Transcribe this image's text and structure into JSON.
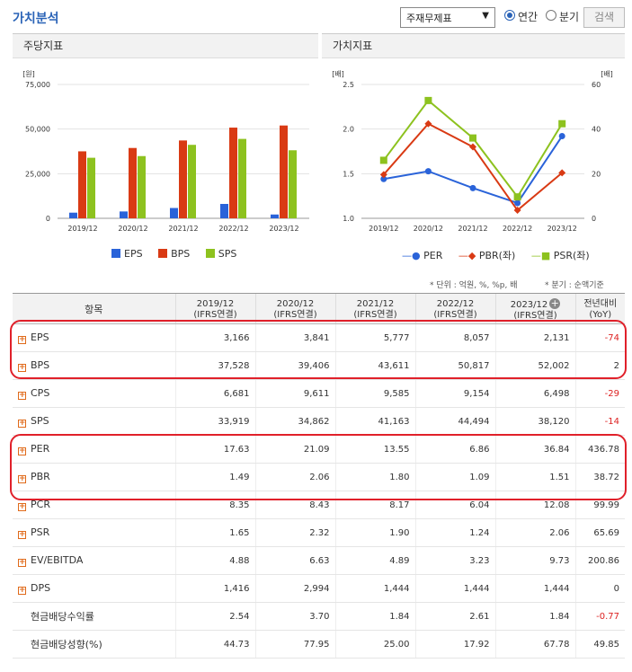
{
  "header": {
    "title": "가치분석",
    "select_value": "주재무제표",
    "radio_annual": "연간",
    "radio_quarter": "분기",
    "search_label": "검색"
  },
  "panels": {
    "left_title": "주당지표",
    "right_title": "가치지표"
  },
  "colors": {
    "eps": "#2a63d9",
    "bps": "#d93a14",
    "sps": "#8dc21f",
    "per": "#2a63d9",
    "pbr": "#d93a14",
    "psr": "#8dc21f"
  },
  "chart_data": [
    {
      "type": "bar",
      "unit_label": "[원]",
      "categories": [
        "2019/12",
        "2020/12",
        "2021/12",
        "2022/12",
        "2023/12"
      ],
      "ylim": [
        0,
        75000
      ],
      "yticks": [
        "75,000",
        "50,000",
        "25,000",
        "0"
      ],
      "series": [
        {
          "name": "EPS",
          "values": [
            3166,
            3841,
            5777,
            8057,
            2131
          ]
        },
        {
          "name": "BPS",
          "values": [
            37528,
            39406,
            43611,
            50817,
            52002
          ]
        },
        {
          "name": "SPS",
          "values": [
            33919,
            34862,
            41163,
            44494,
            38120
          ]
        }
      ],
      "legend": "bottom"
    },
    {
      "type": "line",
      "left_unit_label": "[배]",
      "right_unit_label": "[배]",
      "categories": [
        "2019/12",
        "2020/12",
        "2021/12",
        "2022/12",
        "2023/12"
      ],
      "ylim_left": [
        1.0,
        2.5
      ],
      "ylim_right": [
        0,
        60
      ],
      "yticks_left": [
        "2.5",
        "2.0",
        "1.5",
        "1.0"
      ],
      "yticks_right": [
        "60",
        "40",
        "20",
        "0"
      ],
      "series": [
        {
          "name": "PER",
          "axis": "right",
          "values": [
            17.63,
            21.09,
            13.55,
            6.86,
            36.84
          ]
        },
        {
          "name": "PBR(좌)",
          "axis": "left",
          "values": [
            1.49,
            2.06,
            1.8,
            1.09,
            1.51
          ]
        },
        {
          "name": "PSR(좌)",
          "axis": "left",
          "values": [
            1.65,
            2.32,
            1.9,
            1.24,
            2.06
          ]
        }
      ],
      "legend": "bottom"
    }
  ],
  "notes": {
    "unit": "* 단위 : 억원, %, %p, 배",
    "quarter": "* 분기 : 순액기준"
  },
  "table": {
    "headers": [
      "항목",
      "2019/12\n(IFRS연결)",
      "2020/12\n(IFRS연결)",
      "2021/12\n(IFRS연결)",
      "2022/12\n(IFRS연결)",
      "2023/12\n(IFRS연결)",
      "전년대비\n(YoY)"
    ],
    "rows": [
      {
        "label": "EPS",
        "expand": true,
        "values": [
          "3,166",
          "3,841",
          "5,777",
          "8,057",
          "2,131",
          "-74"
        ]
      },
      {
        "label": "BPS",
        "expand": true,
        "values": [
          "37,528",
          "39,406",
          "43,611",
          "50,817",
          "52,002",
          "2"
        ]
      },
      {
        "label": "CPS",
        "expand": true,
        "values": [
          "6,681",
          "9,611",
          "9,585",
          "9,154",
          "6,498",
          "-29"
        ]
      },
      {
        "label": "SPS",
        "expand": true,
        "values": [
          "33,919",
          "34,862",
          "41,163",
          "44,494",
          "38,120",
          "-14"
        ]
      },
      {
        "label": "PER",
        "expand": true,
        "values": [
          "17.63",
          "21.09",
          "13.55",
          "6.86",
          "36.84",
          "436.78"
        ]
      },
      {
        "label": "PBR",
        "expand": true,
        "values": [
          "1.49",
          "2.06",
          "1.80",
          "1.09",
          "1.51",
          "38.72"
        ]
      },
      {
        "label": "PCR",
        "expand": true,
        "values": [
          "8.35",
          "8.43",
          "8.17",
          "6.04",
          "12.08",
          "99.99"
        ]
      },
      {
        "label": "PSR",
        "expand": true,
        "values": [
          "1.65",
          "2.32",
          "1.90",
          "1.24",
          "2.06",
          "65.69"
        ]
      },
      {
        "label": "EV/EBITDA",
        "expand": true,
        "values": [
          "4.88",
          "6.63",
          "4.89",
          "3.23",
          "9.73",
          "200.86"
        ]
      },
      {
        "label": "DPS",
        "expand": true,
        "values": [
          "1,416",
          "2,994",
          "1,444",
          "1,444",
          "1,444",
          "0"
        ]
      },
      {
        "label": "현금배당수익률",
        "expand": false,
        "values": [
          "2.54",
          "3.70",
          "1.84",
          "2.61",
          "1.84",
          "-0.77"
        ]
      },
      {
        "label": "현금배당성향(%)",
        "expand": false,
        "values": [
          "44.73",
          "77.95",
          "25.00",
          "17.92",
          "67.78",
          "49.85"
        ]
      }
    ]
  }
}
